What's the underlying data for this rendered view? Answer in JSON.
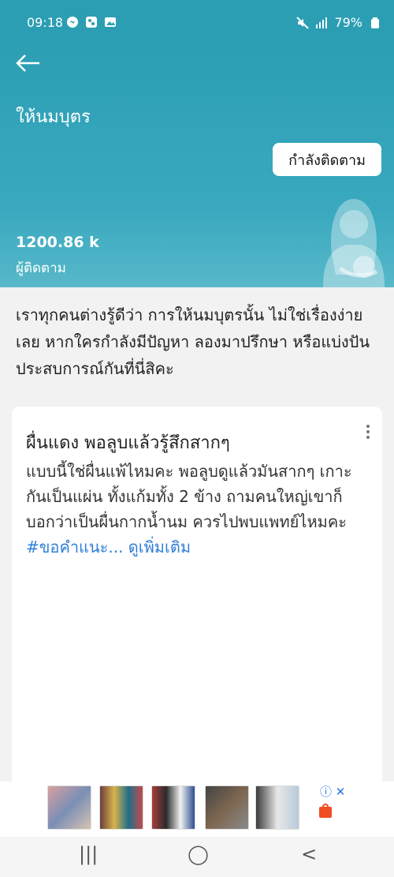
{
  "status": {
    "time": "09:18",
    "battery": "79%",
    "signal_icon": "signal-bars-icon",
    "mute_icon": "mute-icon"
  },
  "header": {
    "title": "ให้นมบุตร",
    "follow_label": "กำลังติดตาม",
    "followers_count": "1200.86 k",
    "followers_label": "ผู้ติดตาม"
  },
  "description": "เราทุกคนต่างรู้ดีว่า การให้นมบุตรนั้น ไม่ใช่เรื่องง่ายเลย หากใครกำลังมีปัญหา ลองมาปรึกษา หรือแบ่งปันประสบการณ์กันที่นี่สิคะ",
  "post": {
    "title": "ผื่นแดง พอลูบแล้วรู้สึกสากๆ",
    "body": "แบบนี้ใช่ผื่นแพ้ไหมคะ พอลูบดูแล้วมันสากๆ เกาะกันเป็นแผ่น ทั้งแก้มทั้ง 2 ข้าง ถามคนใหญ่เขาก็บอกว่าเป็นผื่นกากน้ำนม ควรไปพบแพทย์ไหมคะ",
    "hashtag": "#ขอคำแนะ...",
    "see_more": "ดูเพิ่มเติม"
  },
  "ad": {
    "info_icon": "info-icon",
    "close_icon": "close-icon"
  },
  "accent_color": "#2b9eb3",
  "link_color": "#2f7fd8"
}
